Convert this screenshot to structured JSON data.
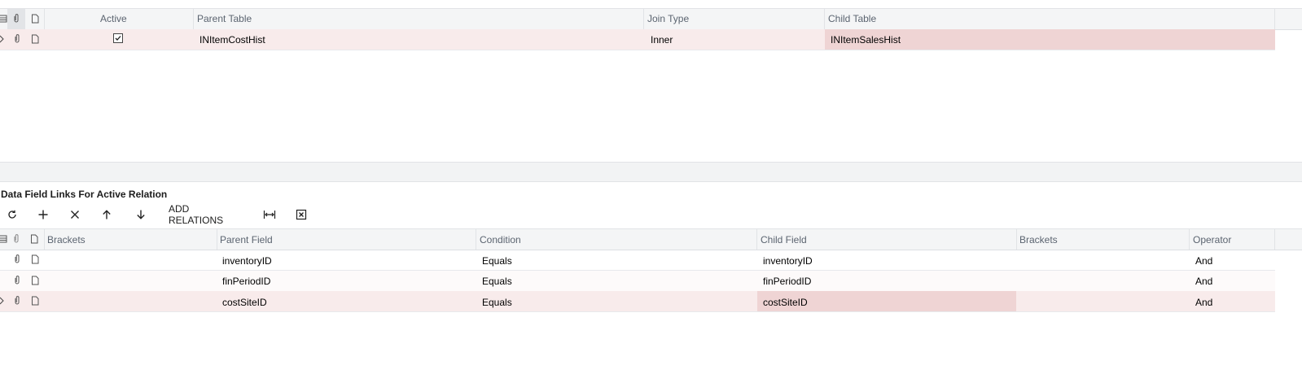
{
  "relations": {
    "headers": {
      "active": "Active",
      "parent_table": "Parent Table",
      "join_type": "Join Type",
      "child_table": "Child Table"
    },
    "rows": [
      {
        "active": true,
        "parent_table": "INItemCostHist",
        "join_type": "Inner",
        "child_table": "INItemSalesHist"
      }
    ]
  },
  "links": {
    "title": "Data Field Links For Active Relation",
    "toolbar": {
      "refresh_icon": "refresh-icon",
      "add_icon": "plus-icon",
      "delete_icon": "close-icon",
      "up_icon": "arrow-up-icon",
      "down_icon": "arrow-down-icon",
      "add_relations_label": "ADD RELATIONS",
      "fit_icon": "fit-columns-icon",
      "export_icon": "excel-export-icon"
    },
    "headers": {
      "brackets_open": "Brackets",
      "parent_field": "Parent Field",
      "condition": "Condition",
      "child_field": "Child Field",
      "brackets_close": "Brackets",
      "operator": "Operator"
    },
    "rows": [
      {
        "parent_field": "inventoryID",
        "condition": "Equals",
        "child_field": "inventoryID",
        "operator": "And"
      },
      {
        "parent_field": "finPeriodID",
        "condition": "Equals",
        "child_field": "finPeriodID",
        "operator": "And"
      },
      {
        "parent_field": "costSiteID",
        "condition": "Equals",
        "child_field": "costSiteID",
        "operator": "And"
      }
    ]
  },
  "colors": {
    "selected_row": "#f8ebeb",
    "selected_cell": "#efd4d4",
    "header_bg": "#f4f5f6"
  }
}
